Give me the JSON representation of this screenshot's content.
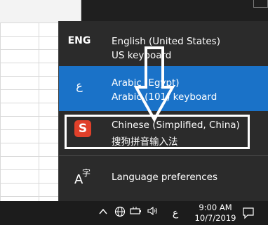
{
  "flyout": {
    "items": [
      {
        "code": "ENG",
        "name": "English (United States)",
        "keyboard": "US keyboard"
      },
      {
        "code": "ع",
        "name": "Arabic (Egypt)",
        "keyboard": "Arabic (101) keyboard",
        "selected": true
      },
      {
        "code": "S",
        "name": "Chinese (Simplified, China)",
        "keyboard": "搜狗拼音输入法"
      }
    ],
    "preferences": {
      "label": "Language preferences",
      "icon_a": "A",
      "icon_zi": "字"
    }
  },
  "annotation": {
    "arrow": "down-arrow",
    "highlight": "Chinese (Simplified, China)"
  },
  "taskbar": {
    "chevron": "^",
    "ime_indicator": "ع",
    "time": "9:00 AM",
    "date": "10/7/2019"
  },
  "colors": {
    "flyout_bg": "#2b2b2b",
    "selected_bg": "#1a72c8",
    "taskbar_bg": "#1c1c1c",
    "sogou_red": "#e0402a"
  }
}
